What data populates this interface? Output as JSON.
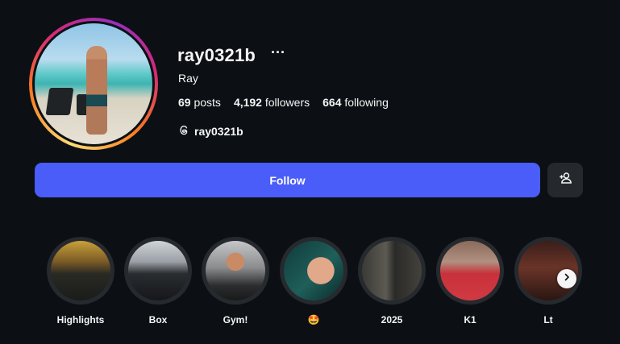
{
  "profile": {
    "username": "ray0321b",
    "more_label": "···",
    "full_name": "Ray",
    "stats": {
      "posts_count": "69",
      "posts_label": "posts",
      "followers_count": "4,192",
      "followers_label": "followers",
      "following_count": "664",
      "following_label": "following"
    },
    "threads_handle": "ray0321b"
  },
  "actions": {
    "follow_label": "Follow",
    "follow_color": "#4a5df9",
    "suggest_icon": "add-person-icon"
  },
  "highlights": [
    {
      "label": "Highlights"
    },
    {
      "label": "Box"
    },
    {
      "label": "Gym!"
    },
    {
      "label": "🤩"
    },
    {
      "label": "2025"
    },
    {
      "label": "K1"
    },
    {
      "label": "Lt"
    }
  ],
  "highlight_next_icon": "chevron-right-icon",
  "colors": {
    "background": "#0c1014",
    "accent": "#4a5df9",
    "ring": "#262a2f"
  }
}
